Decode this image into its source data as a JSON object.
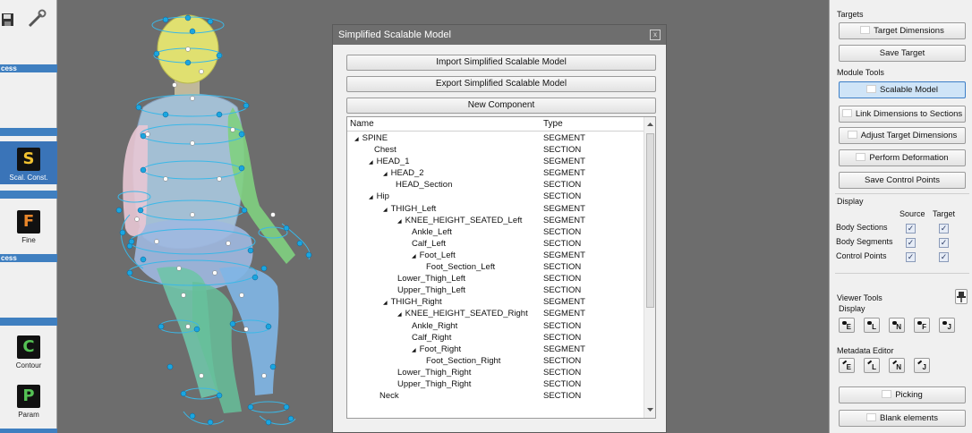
{
  "left_toolbar": {
    "bars": [
      "cess",
      "cess"
    ],
    "tools": [
      {
        "letter": "S",
        "label": "Scal. Const.",
        "color": "#f2c230"
      },
      {
        "letter": "F",
        "label": "Fine",
        "color": "#e8862a"
      },
      {
        "letter": "C",
        "label": "Contour",
        "color": "#55c255"
      },
      {
        "letter": "P",
        "label": "Param",
        "color": "#55c255"
      }
    ]
  },
  "dialog": {
    "title": "Simplified Scalable Model",
    "close": "x",
    "buttons": {
      "import": "Import Simplified Scalable Model",
      "export": "Export Simplified Scalable Model",
      "new_component": "New Component"
    },
    "tree": {
      "columns": {
        "name": "Name",
        "type": "Type"
      },
      "rows": [
        {
          "name": "SPINE",
          "type": "SEGMENT",
          "arrow": "◢"
        },
        {
          "name": "Chest",
          "type": "SECTION",
          "arrow": ""
        },
        {
          "name": "HEAD_1",
          "type": "SEGMENT",
          "arrow": "◢"
        },
        {
          "name": "HEAD_2",
          "type": "SEGMENT",
          "arrow": "◢"
        },
        {
          "name": "HEAD_Section",
          "type": "SECTION",
          "arrow": ""
        },
        {
          "name": "Hip",
          "type": "SECTION",
          "arrow": "◢"
        },
        {
          "name": "THIGH_Left",
          "type": "SEGMENT",
          "arrow": "◢"
        },
        {
          "name": "KNEE_HEIGHT_SEATED_Left",
          "type": "SEGMENT",
          "arrow": "◢"
        },
        {
          "name": "Ankle_Left",
          "type": "SECTION",
          "arrow": ""
        },
        {
          "name": "Calf_Left",
          "type": "SECTION",
          "arrow": ""
        },
        {
          "name": "Foot_Left",
          "type": "SEGMENT",
          "arrow": "◢"
        },
        {
          "name": "Foot_Section_Left",
          "type": "SECTION",
          "arrow": ""
        },
        {
          "name": "Lower_Thigh_Left",
          "type": "SECTION",
          "arrow": ""
        },
        {
          "name": "Upper_Thigh_Left",
          "type": "SECTION",
          "arrow": ""
        },
        {
          "name": "THIGH_Right",
          "type": "SEGMENT",
          "arrow": "◢"
        },
        {
          "name": "KNEE_HEIGHT_SEATED_Right",
          "type": "SEGMENT",
          "arrow": "◢"
        },
        {
          "name": "Ankle_Right",
          "type": "SECTION",
          "arrow": ""
        },
        {
          "name": "Calf_Right",
          "type": "SECTION",
          "arrow": ""
        },
        {
          "name": "Foot_Right",
          "type": "SEGMENT",
          "arrow": "◢"
        },
        {
          "name": "Foot_Section_Right",
          "type": "SECTION",
          "arrow": ""
        },
        {
          "name": "Lower_Thigh_Right",
          "type": "SECTION",
          "arrow": ""
        },
        {
          "name": "Upper_Thigh_Right",
          "type": "SECTION",
          "arrow": ""
        },
        {
          "name": "Neck",
          "type": "SECTION",
          "arrow": ""
        }
      ]
    }
  },
  "right_panel": {
    "targets_label": "Targets",
    "target_dimensions": "Target Dimensions",
    "save_target": "Save Target",
    "module_tools_label": "Module Tools",
    "scalable_model": "Scalable Model",
    "link_dimensions": "Link Dimensions to Sections",
    "adjust_target": "Adjust Target Dimensions",
    "perform_deformation": "Perform Deformation",
    "save_control_points": "Save Control Points",
    "display_label": "Display",
    "col_source": "Source",
    "col_target": "Target",
    "display_rows": [
      {
        "label": "Body Sections",
        "source": true,
        "target": true
      },
      {
        "label": "Body Segments",
        "source": true,
        "target": true
      },
      {
        "label": "Control Points",
        "source": true,
        "target": true
      }
    ],
    "viewer_tools_label": "Viewer Tools",
    "viewer_display_label": "Display",
    "viewer_display_buttons": [
      "E",
      "L",
      "N",
      "F",
      "J"
    ],
    "metadata_editor_label": "Metadata Editor",
    "metadata_buttons": [
      "E",
      "L",
      "N",
      "J"
    ],
    "picking": "Picking",
    "blank_elements": "Blank elements"
  }
}
